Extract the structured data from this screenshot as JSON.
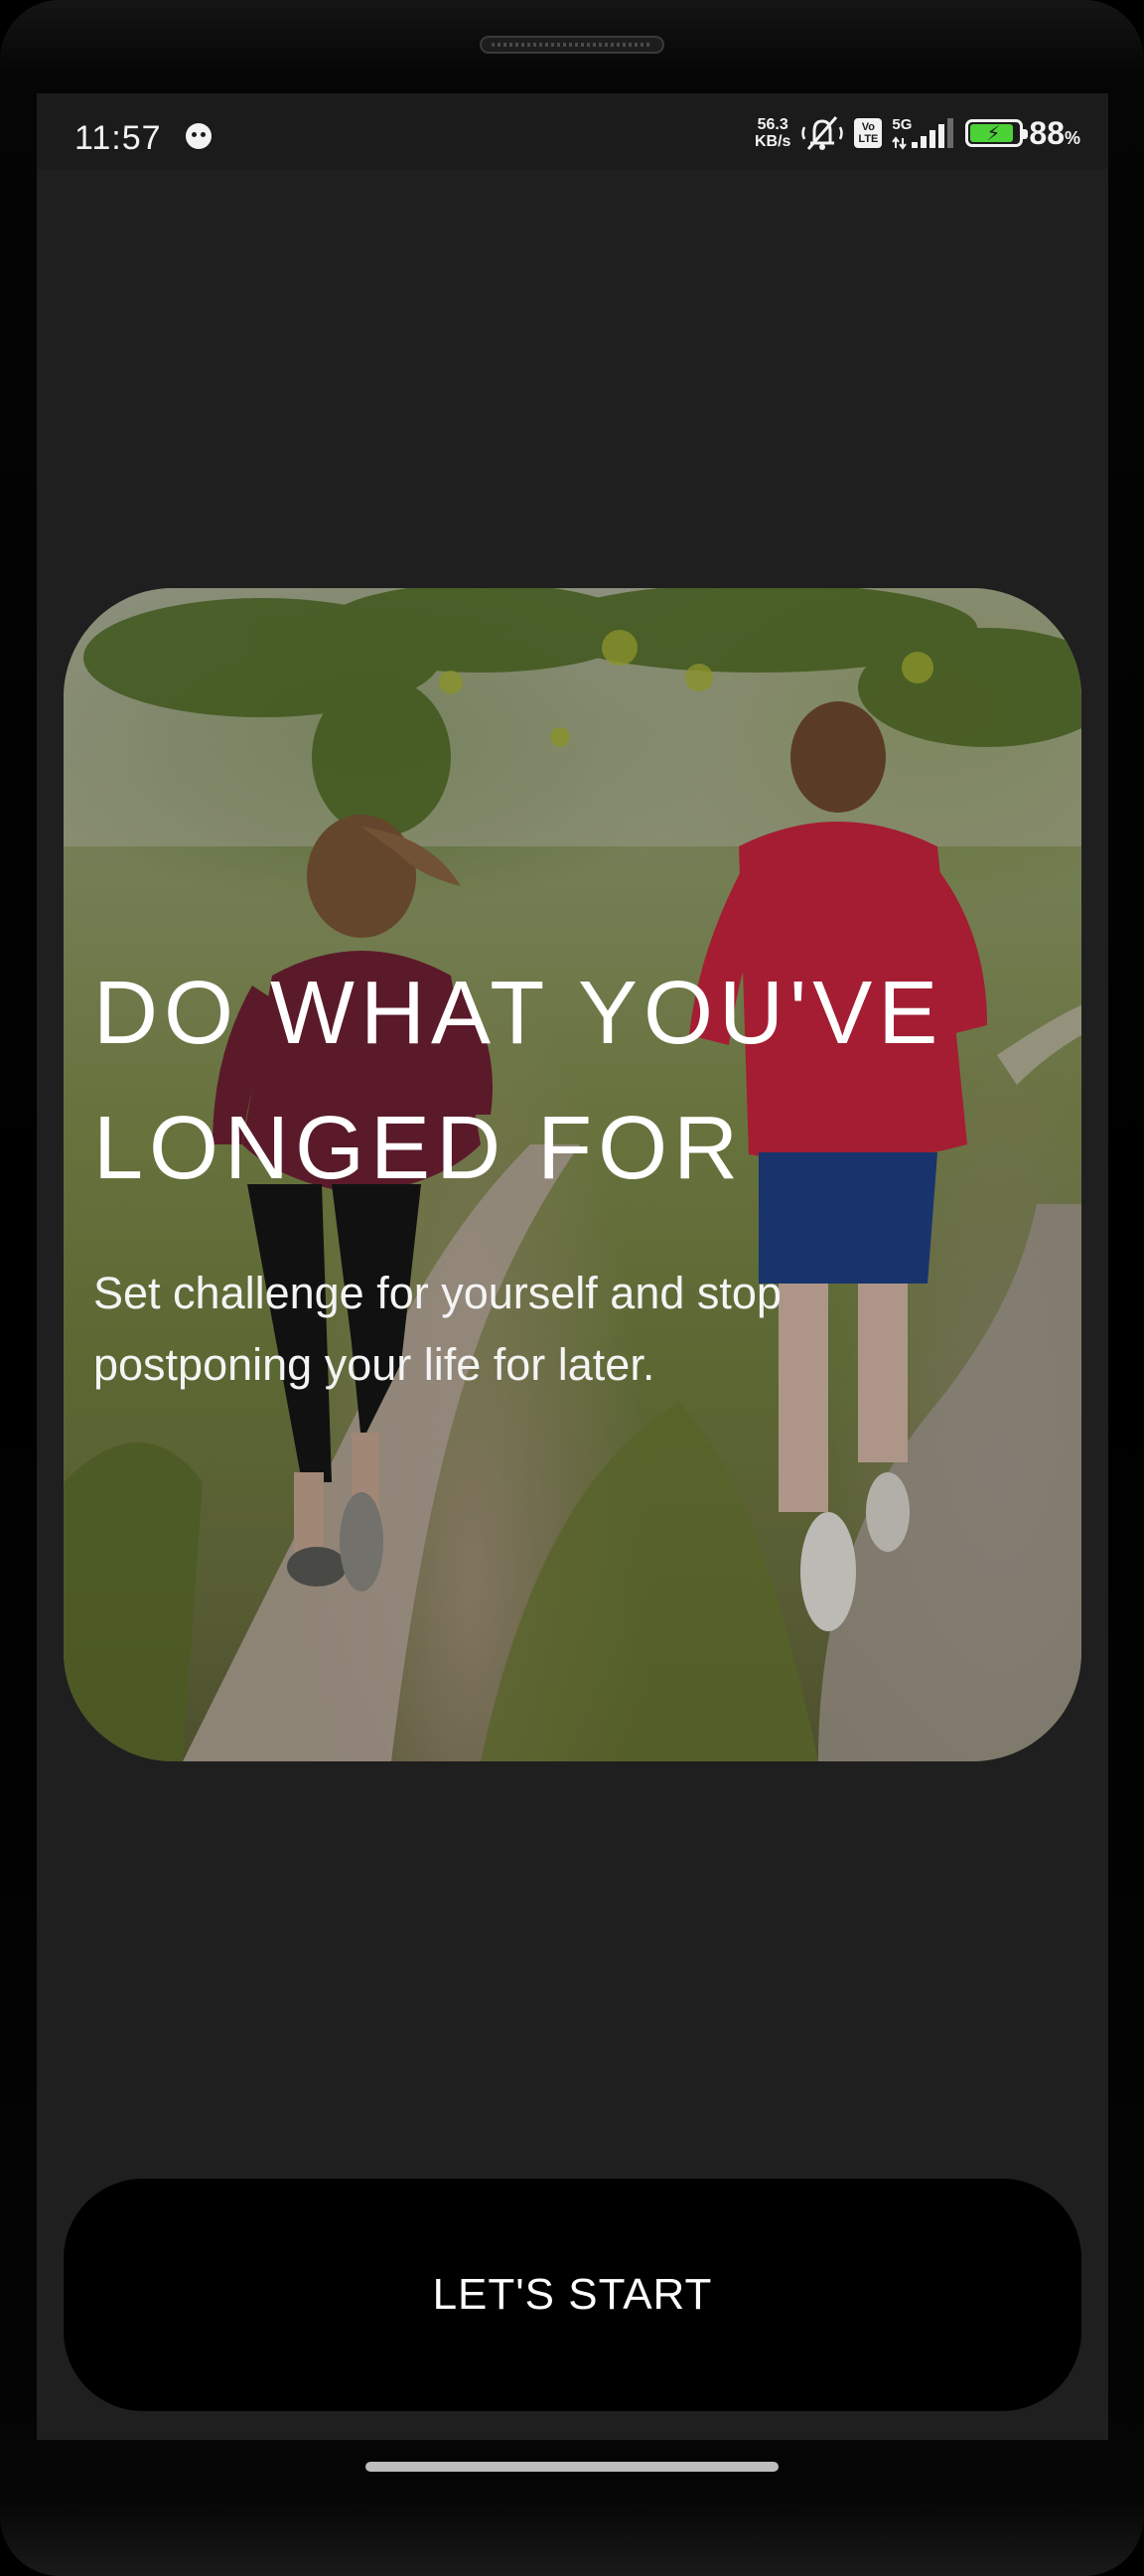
{
  "status_bar": {
    "time": "11:57",
    "net_speed_value": "56.3",
    "net_speed_unit": "KB/s",
    "volte_top": "Vo",
    "volte_bottom": "LTE",
    "network": "5G",
    "battery_percent": "88",
    "battery_percent_sign": "%",
    "battery_level": 0.88
  },
  "hero": {
    "title": "DO WHAT YOU'VE LONGED FOR",
    "subtitle": "Set challenge for yourself and stop postponing your life for later."
  },
  "cta": {
    "label": "LET'S START"
  },
  "colors": {
    "screen_bg": "#1f1f1f",
    "button_bg": "#000000",
    "text": "#ffffff"
  },
  "icons": [
    "notification-cat-icon",
    "muted-vibration-icon",
    "volte-icon",
    "signal-icon",
    "battery-charging-icon"
  ]
}
